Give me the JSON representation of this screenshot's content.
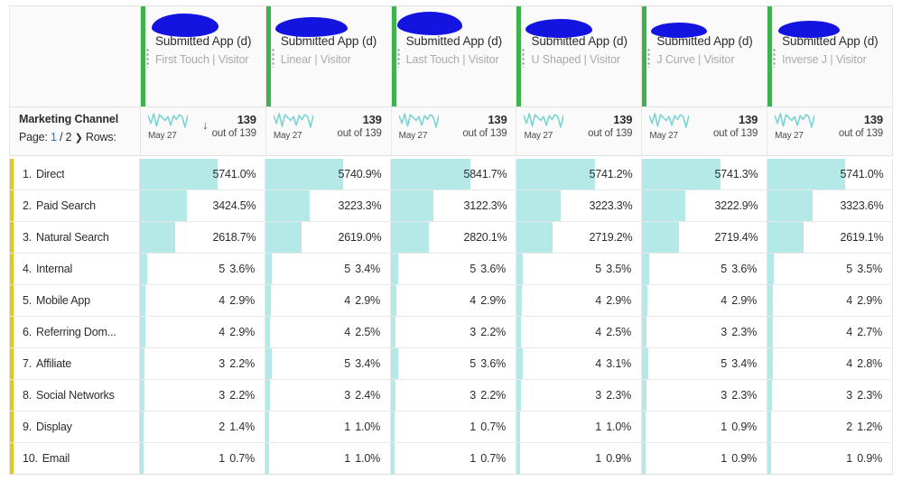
{
  "header": {
    "corner_empty": "",
    "columns": [
      {
        "title": "Submitted App (d)",
        "subtitle": "First Touch | Visitor",
        "redacted": true,
        "accent_color": "#3fb24f"
      },
      {
        "title": "Submitted App (d)",
        "subtitle": "Linear | Visitor",
        "redacted": true,
        "accent_color": "#3fb24f"
      },
      {
        "title": "Submitted App (d)",
        "subtitle": "Last Touch | Visitor",
        "redacted": true,
        "accent_color": "#3fb24f"
      },
      {
        "title": "Submitted App (d)",
        "subtitle": "U Shaped | Visitor",
        "redacted": true,
        "accent_color": "#3fb24f"
      },
      {
        "title": "Submitted App (d)",
        "subtitle": "J Curve | Visitor",
        "redacted": true,
        "accent_color": "#3fb24f"
      },
      {
        "title": "Submitted App (d)",
        "subtitle": "Inverse J | Visitor",
        "redacted": true,
        "accent_color": "#3fb24f"
      }
    ]
  },
  "dimension": {
    "name": "Marketing Channel",
    "page_label": "Page:",
    "page_current": "1",
    "page_sep": "/ 2",
    "page_next_icon": "chevron-right-icon",
    "rows_label": "Rows:"
  },
  "metrics": [
    {
      "sparkline_label": "May 27",
      "sorted": true,
      "sort_icon": "arrow-down-icon",
      "total": "139",
      "out_of": "out of 139"
    },
    {
      "sparkline_label": "May 27",
      "sorted": false,
      "total": "139",
      "out_of": "out of 139"
    },
    {
      "sparkline_label": "May 27",
      "sorted": false,
      "total": "139",
      "out_of": "out of 139"
    },
    {
      "sparkline_label": "May 27",
      "sorted": false,
      "total": "139",
      "out_of": "out of 139"
    },
    {
      "sparkline_label": "May 27",
      "sorted": false,
      "total": "139",
      "out_of": "out of 139"
    },
    {
      "sparkline_label": "May 27",
      "sorted": false,
      "total": "139",
      "out_of": "out of 139"
    }
  ],
  "chart_data": {
    "type": "table",
    "title": "Marketing Channel by Attribution Model",
    "xlabel": "",
    "ylabel": "",
    "row_dimension": "Marketing Channel",
    "categories": [
      "Direct",
      "Paid Search",
      "Natural Search",
      "Internal",
      "Mobile App",
      "Referring Dom...",
      "Affiliate",
      "Social Networks",
      "Display",
      "Email"
    ],
    "series": [
      {
        "name": "First Touch | Visitor",
        "values": [
          57,
          34,
          26,
          5,
          4,
          4,
          3,
          3,
          2,
          1
        ],
        "percents": [
          "41.0%",
          "24.5%",
          "18.7%",
          "3.6%",
          "2.9%",
          "2.9%",
          "2.2%",
          "2.2%",
          "1.4%",
          "0.7%"
        ],
        "total": 139
      },
      {
        "name": "Linear | Visitor",
        "values": [
          57,
          32,
          26,
          5,
          4,
          4,
          5,
          3,
          1,
          1
        ],
        "percents": [
          "40.9%",
          "23.3%",
          "19.0%",
          "3.4%",
          "2.9%",
          "2.5%",
          "3.4%",
          "2.4%",
          "1.0%",
          "1.0%"
        ],
        "total": 139
      },
      {
        "name": "Last Touch | Visitor",
        "values": [
          58,
          31,
          28,
          5,
          4,
          3,
          5,
          3,
          1,
          1
        ],
        "percents": [
          "41.7%",
          "22.3%",
          "20.1%",
          "3.6%",
          "2.9%",
          "2.2%",
          "3.6%",
          "2.2%",
          "0.7%",
          "0.7%"
        ],
        "total": 139
      },
      {
        "name": "U Shaped | Visitor",
        "values": [
          57,
          32,
          27,
          5,
          4,
          4,
          4,
          3,
          1,
          1
        ],
        "percents": [
          "41.2%",
          "23.3%",
          "19.2%",
          "3.5%",
          "2.9%",
          "2.5%",
          "3.1%",
          "2.3%",
          "1.0%",
          "0.9%"
        ],
        "total": 139
      },
      {
        "name": "J Curve | Visitor",
        "values": [
          57,
          32,
          27,
          5,
          4,
          3,
          5,
          3,
          1,
          1
        ],
        "percents": [
          "41.3%",
          "22.9%",
          "19.4%",
          "3.6%",
          "2.9%",
          "2.3%",
          "3.4%",
          "2.3%",
          "0.9%",
          "0.9%"
        ],
        "total": 139
      },
      {
        "name": "Inverse J | Visitor",
        "values": [
          57,
          33,
          26,
          5,
          4,
          4,
          4,
          3,
          2,
          1
        ],
        "percents": [
          "41.0%",
          "23.6%",
          "19.1%",
          "3.5%",
          "2.9%",
          "2.7%",
          "2.8%",
          "2.3%",
          "1.2%",
          "0.9%"
        ],
        "total": 139
      }
    ]
  },
  "rows": [
    {
      "rank": "1.",
      "label": "Direct",
      "cells": [
        {
          "value": "57",
          "pct": "41.0%",
          "bar": 41.0
        },
        {
          "value": "57",
          "pct": "40.9%",
          "bar": 40.9
        },
        {
          "value": "58",
          "pct": "41.7%",
          "bar": 41.7
        },
        {
          "value": "57",
          "pct": "41.2%",
          "bar": 41.2
        },
        {
          "value": "57",
          "pct": "41.3%",
          "bar": 41.3
        },
        {
          "value": "57",
          "pct": "41.0%",
          "bar": 41.0
        }
      ]
    },
    {
      "rank": "2.",
      "label": "Paid Search",
      "cells": [
        {
          "value": "34",
          "pct": "24.5%",
          "bar": 24.5
        },
        {
          "value": "32",
          "pct": "23.3%",
          "bar": 23.3
        },
        {
          "value": "31",
          "pct": "22.3%",
          "bar": 22.3
        },
        {
          "value": "32",
          "pct": "23.3%",
          "bar": 23.3
        },
        {
          "value": "32",
          "pct": "22.9%",
          "bar": 22.9
        },
        {
          "value": "33",
          "pct": "23.6%",
          "bar": 23.6
        }
      ]
    },
    {
      "rank": "3.",
      "label": "Natural Search",
      "cells": [
        {
          "value": "26",
          "pct": "18.7%",
          "bar": 18.7
        },
        {
          "value": "26",
          "pct": "19.0%",
          "bar": 19.0
        },
        {
          "value": "28",
          "pct": "20.1%",
          "bar": 20.1
        },
        {
          "value": "27",
          "pct": "19.2%",
          "bar": 19.2
        },
        {
          "value": "27",
          "pct": "19.4%",
          "bar": 19.4
        },
        {
          "value": "26",
          "pct": "19.1%",
          "bar": 19.1
        }
      ]
    },
    {
      "rank": "4.",
      "label": "Internal",
      "cells": [
        {
          "value": "5",
          "pct": "3.6%",
          "bar": 3.6
        },
        {
          "value": "5",
          "pct": "3.4%",
          "bar": 3.4
        },
        {
          "value": "5",
          "pct": "3.6%",
          "bar": 3.6
        },
        {
          "value": "5",
          "pct": "3.5%",
          "bar": 3.5
        },
        {
          "value": "5",
          "pct": "3.6%",
          "bar": 3.6
        },
        {
          "value": "5",
          "pct": "3.5%",
          "bar": 3.5
        }
      ]
    },
    {
      "rank": "5.",
      "label": "Mobile App",
      "cells": [
        {
          "value": "4",
          "pct": "2.9%",
          "bar": 2.9
        },
        {
          "value": "4",
          "pct": "2.9%",
          "bar": 2.9
        },
        {
          "value": "4",
          "pct": "2.9%",
          "bar": 2.9
        },
        {
          "value": "4",
          "pct": "2.9%",
          "bar": 2.9
        },
        {
          "value": "4",
          "pct": "2.9%",
          "bar": 2.9
        },
        {
          "value": "4",
          "pct": "2.9%",
          "bar": 2.9
        }
      ]
    },
    {
      "rank": "6.",
      "label": "Referring Dom...",
      "cells": [
        {
          "value": "4",
          "pct": "2.9%",
          "bar": 2.9
        },
        {
          "value": "4",
          "pct": "2.5%",
          "bar": 2.5
        },
        {
          "value": "3",
          "pct": "2.2%",
          "bar": 2.2
        },
        {
          "value": "4",
          "pct": "2.5%",
          "bar": 2.5
        },
        {
          "value": "3",
          "pct": "2.3%",
          "bar": 2.3
        },
        {
          "value": "4",
          "pct": "2.7%",
          "bar": 2.7
        }
      ]
    },
    {
      "rank": "7.",
      "label": "Affiliate",
      "cells": [
        {
          "value": "3",
          "pct": "2.2%",
          "bar": 2.2
        },
        {
          "value": "5",
          "pct": "3.4%",
          "bar": 3.4
        },
        {
          "value": "5",
          "pct": "3.6%",
          "bar": 3.6
        },
        {
          "value": "4",
          "pct": "3.1%",
          "bar": 3.1
        },
        {
          "value": "5",
          "pct": "3.4%",
          "bar": 3.4
        },
        {
          "value": "4",
          "pct": "2.8%",
          "bar": 2.8
        }
      ]
    },
    {
      "rank": "8.",
      "label": "Social Networks",
      "cells": [
        {
          "value": "3",
          "pct": "2.2%",
          "bar": 2.2
        },
        {
          "value": "3",
          "pct": "2.4%",
          "bar": 2.4
        },
        {
          "value": "3",
          "pct": "2.2%",
          "bar": 2.2
        },
        {
          "value": "3",
          "pct": "2.3%",
          "bar": 2.3
        },
        {
          "value": "3",
          "pct": "2.3%",
          "bar": 2.3
        },
        {
          "value": "3",
          "pct": "2.3%",
          "bar": 2.3
        }
      ]
    },
    {
      "rank": "9.",
      "label": "Display",
      "cells": [
        {
          "value": "2",
          "pct": "1.4%",
          "bar": 1.4
        },
        {
          "value": "1",
          "pct": "1.0%",
          "bar": 1.0
        },
        {
          "value": "1",
          "pct": "0.7%",
          "bar": 0.7
        },
        {
          "value": "1",
          "pct": "1.0%",
          "bar": 1.0
        },
        {
          "value": "1",
          "pct": "0.9%",
          "bar": 0.9
        },
        {
          "value": "2",
          "pct": "1.2%",
          "bar": 1.2
        }
      ]
    },
    {
      "rank": "10.",
      "label": "Email",
      "cells": [
        {
          "value": "1",
          "pct": "0.7%",
          "bar": 0.7
        },
        {
          "value": "1",
          "pct": "1.0%",
          "bar": 1.0
        },
        {
          "value": "1",
          "pct": "0.7%",
          "bar": 0.7
        },
        {
          "value": "1",
          "pct": "0.9%",
          "bar": 0.9
        },
        {
          "value": "1",
          "pct": "0.9%",
          "bar": 0.9
        },
        {
          "value": "1",
          "pct": "0.9%",
          "bar": 0.9
        }
      ]
    }
  ],
  "colors": {
    "bar_fill": "#b5e9e8",
    "header_accent": "#3fb24f",
    "dimension_accent": "#e8c51a",
    "link": "#1473e6",
    "redaction": "#1414e0"
  }
}
